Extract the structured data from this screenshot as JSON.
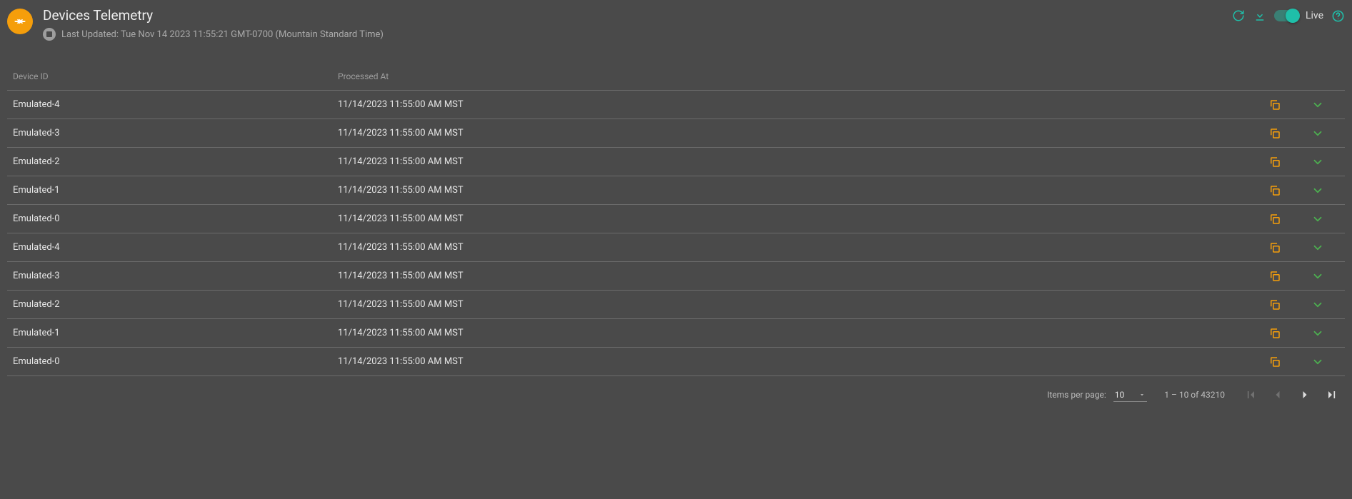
{
  "header": {
    "title": "Devices Telemetry",
    "last_updated": "Last Updated: Tue Nov 14 2023 11:55:21 GMT-0700 (Mountain Standard Time)",
    "live_label": "Live"
  },
  "columns": {
    "device_id": "Device ID",
    "processed_at": "Processed At"
  },
  "rows": [
    {
      "device_id": "Emulated-4",
      "processed_at": "11/14/2023 11:55:00 AM MST"
    },
    {
      "device_id": "Emulated-3",
      "processed_at": "11/14/2023 11:55:00 AM MST"
    },
    {
      "device_id": "Emulated-2",
      "processed_at": "11/14/2023 11:55:00 AM MST"
    },
    {
      "device_id": "Emulated-1",
      "processed_at": "11/14/2023 11:55:00 AM MST"
    },
    {
      "device_id": "Emulated-0",
      "processed_at": "11/14/2023 11:55:00 AM MST"
    },
    {
      "device_id": "Emulated-4",
      "processed_at": "11/14/2023 11:55:00 AM MST"
    },
    {
      "device_id": "Emulated-3",
      "processed_at": "11/14/2023 11:55:00 AM MST"
    },
    {
      "device_id": "Emulated-2",
      "processed_at": "11/14/2023 11:55:00 AM MST"
    },
    {
      "device_id": "Emulated-1",
      "processed_at": "11/14/2023 11:55:00 AM MST"
    },
    {
      "device_id": "Emulated-0",
      "processed_at": "11/14/2023 11:55:00 AM MST"
    }
  ],
  "paginator": {
    "items_per_page_label": "Items per page:",
    "page_size": "10",
    "range_label": "1 – 10 of 43210"
  },
  "colors": {
    "accent_teal": "#1fbfa9",
    "accent_orange": "#f59e0b",
    "accent_green": "#4caf50"
  }
}
